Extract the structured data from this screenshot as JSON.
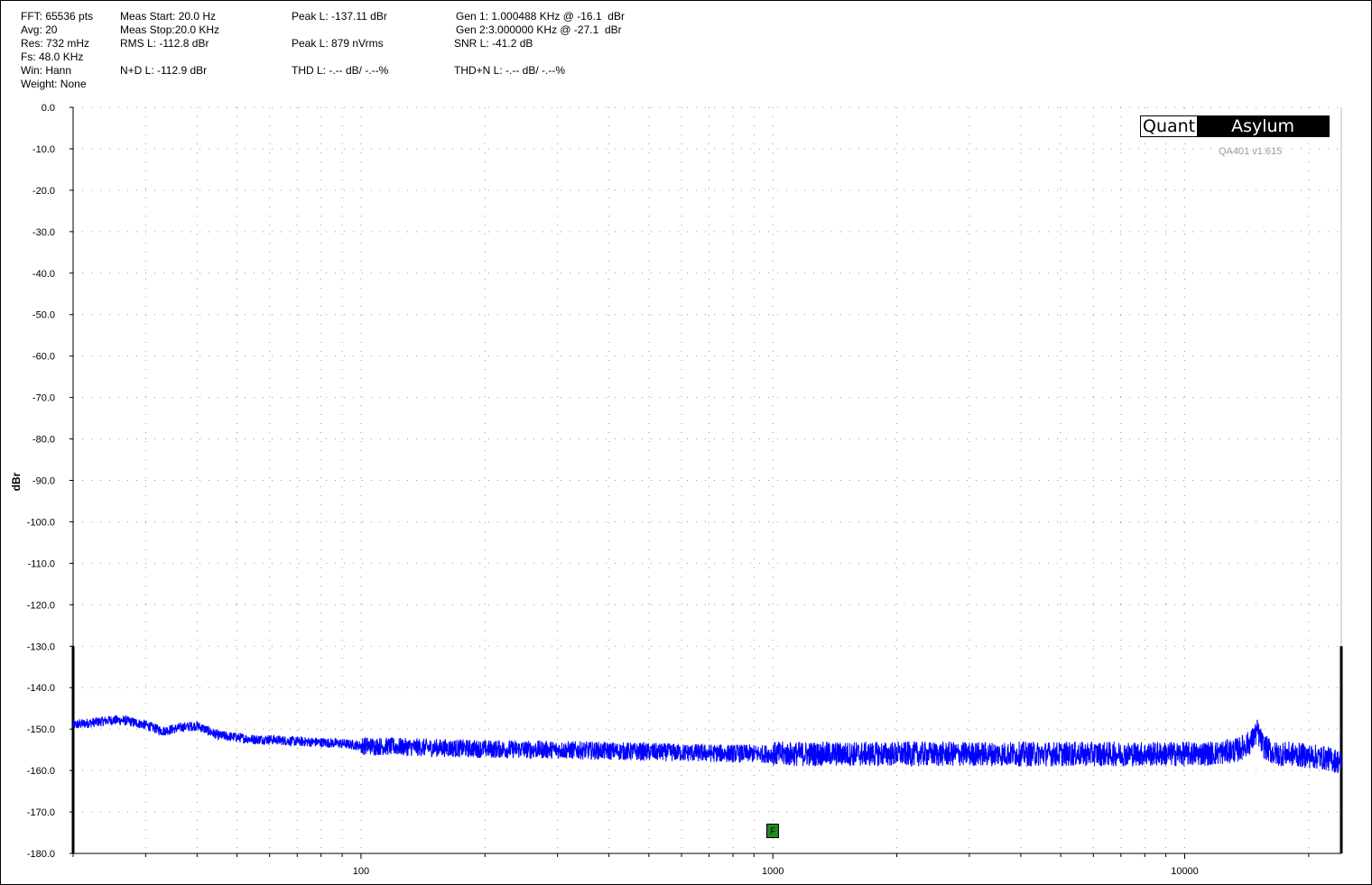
{
  "stats": {
    "fft": "FFT: 65536 pts",
    "avg": "Avg: 20",
    "res": "Res: 732 mHz",
    "fs": "Fs: 48.0 KHz",
    "win": "Win: Hann",
    "weight": "Weight: None",
    "meas_start": "Meas Start: 20.0 Hz",
    "meas_stop": "Meas Stop:20.0 KHz",
    "rms": "RMS L: -112.8 dBr",
    "nd": "N+D L: -112.9 dBr",
    "peak_dbr": "Peak L: -137.11 dBr",
    "peak_nv": "Peak L: 879 nVrms",
    "thd": "THD L: -.-- dB/ -.--%",
    "gen1": "Gen 1: 1.000488 KHz @ -16.1  dBr",
    "gen2": "Gen 2:3.000000 KHz @ -27.1  dBr",
    "snr": "SNR L: -41.2 dB",
    "thdn": "THD+N L: -.-- dB/ -.--%"
  },
  "logo": {
    "part1": "Quant",
    "part2": "Asylum"
  },
  "version": "QA401 v1.615",
  "marker_label": "F",
  "colors": {
    "trace": "#0000ff",
    "marker": "#1f8a1f",
    "grid": "#999999"
  },
  "chart_data": {
    "type": "line",
    "title": "",
    "xlabel": "",
    "ylabel": "dBr",
    "x_scale": "log",
    "xlim": [
      20,
      24000
    ],
    "ylim": [
      -180,
      0
    ],
    "y_ticks": [
      "0.0",
      "-10.0",
      "-20.0",
      "-30.0",
      "-40.0",
      "-50.0",
      "-60.0",
      "-70.0",
      "-80.0",
      "-90.0",
      "-100.0",
      "-110.0",
      "-120.0",
      "-130.0",
      "-140.0",
      "-150.0",
      "-160.0",
      "-170.0",
      "-180.0"
    ],
    "x_tick_labels": [
      {
        "value": 100,
        "label": "100"
      },
      {
        "value": 1000,
        "label": "1000"
      },
      {
        "value": 10000,
        "label": "10000"
      }
    ],
    "grid": true,
    "marker": {
      "x": 1000,
      "label": "F"
    },
    "series": [
      {
        "x": [
          20,
          22,
          25,
          27,
          30,
          33,
          37,
          40,
          45,
          50,
          55,
          60,
          70,
          80,
          90,
          100,
          150,
          200,
          300,
          500,
          700,
          1000,
          2000,
          3000,
          5000,
          7000,
          10000,
          12000,
          13500,
          14500,
          15000,
          15500,
          16500,
          18000,
          20000,
          22000,
          24000
        ],
        "y": [
          -149,
          -148.5,
          -147.8,
          -148,
          -149,
          -150.5,
          -149.5,
          -149.2,
          -151.5,
          -152,
          -152.5,
          -152.5,
          -153,
          -153.2,
          -153.5,
          -154,
          -154.5,
          -154.8,
          -155,
          -155.5,
          -155.8,
          -156,
          -156,
          -156,
          -156,
          -156,
          -156,
          -155.8,
          -155,
          -153,
          -150.5,
          -154,
          -156,
          -156,
          -156.5,
          -157,
          -158
        ]
      }
    ]
  }
}
